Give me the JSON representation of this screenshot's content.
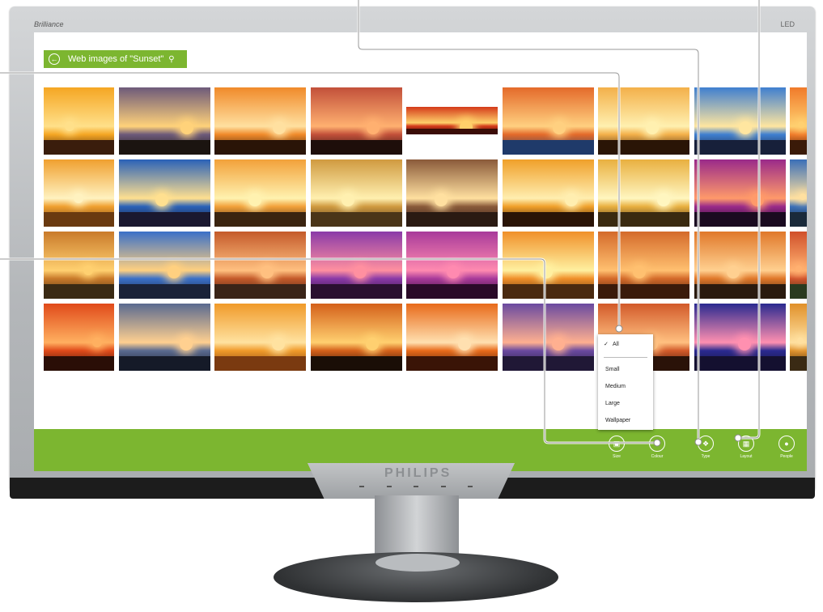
{
  "monitor": {
    "brand_top_left": "Brilliance",
    "brand_top_right": "LED",
    "chin_logo": "PHILIPS"
  },
  "header": {
    "title": "Web images of \"Sunset\"",
    "back_icon": "back-arrow-icon",
    "search_icon": "search-icon"
  },
  "size_menu": {
    "items": [
      {
        "label": "All",
        "checked": true
      },
      {
        "label": "Small",
        "checked": false
      },
      {
        "label": "Medium",
        "checked": false
      },
      {
        "label": "Large",
        "checked": false
      },
      {
        "label": "Wallpaper",
        "checked": false
      }
    ]
  },
  "app_bar": {
    "commands": [
      {
        "label": "Size",
        "icon": "size-icon"
      },
      {
        "label": "Colour",
        "icon": "colour-icon"
      },
      {
        "label": "Type",
        "icon": "type-icon"
      },
      {
        "label": "Layout",
        "icon": "layout-icon"
      },
      {
        "label": "People",
        "icon": "people-icon"
      }
    ]
  },
  "results": {
    "images": [
      {
        "sky": "#f5a623",
        "land": "#3a1d0c",
        "sun": "#ffe08a"
      },
      {
        "sky": "#6d5a7a",
        "land": "#1b1410",
        "sun": "#ffd27a"
      },
      {
        "sky": "#f08a2a",
        "land": "#2a1407",
        "sun": "#ffe0a0"
      },
      {
        "sky": "#c2503a",
        "land": "#1e0e0a",
        "sun": "#ffb070"
      },
      {
        "sky": "#d43a1a",
        "land": "#3b0d07",
        "sun": "#ffd06a"
      },
      {
        "sky": "#e46a2a",
        "land": "#1f3a6a",
        "sun": "#ffd080"
      },
      {
        "sky": "#f3b04a",
        "land": "#2a1506",
        "sun": "#fff0b0"
      },
      {
        "sky": "#3f7fd0",
        "land": "#17203a",
        "sun": "#ffe6a0"
      },
      {
        "sky": "#f07a2a",
        "land": "#3a1a08",
        "sun": "#ffd070"
      },
      {
        "sky": "#f0a030",
        "land": "#6a3a10",
        "sun": "#fff2c0"
      },
      {
        "sky": "#2a62b8",
        "land": "#1a1830",
        "sun": "#ffe090"
      },
      {
        "sky": "#f2a13a",
        "land": "#3a2410",
        "sun": "#fff2b0"
      },
      {
        "sky": "#d09a40",
        "land": "#4a3518",
        "sun": "#fff0b0"
      },
      {
        "sky": "#8a5a3a",
        "land": "#2a1a12",
        "sun": "#ffe0a0"
      },
      {
        "sky": "#f0a02a",
        "land": "#2a1406",
        "sun": "#ffeeb0"
      },
      {
        "sky": "#e9b040",
        "land": "#3a2a10",
        "sun": "#fff6c0"
      },
      {
        "sky": "#9a2a8a",
        "land": "#1a0a20",
        "sun": "#ff9a6a"
      },
      {
        "sky": "#3a6fb8",
        "land": "#1a2a3a",
        "sun": "#ffe0a0"
      },
      {
        "sky": "#c97a2a",
        "land": "#3a2a14",
        "sun": "#ffd070"
      },
      {
        "sky": "#3a70c8",
        "land": "#1a2238",
        "sun": "#ffd080"
      },
      {
        "sky": "#c45a2a",
        "land": "#3a2418",
        "sun": "#ffc080"
      },
      {
        "sky": "#8a3aa8",
        "land": "#2a1030",
        "sun": "#ff90a0"
      },
      {
        "sky": "#a83a9a",
        "land": "#2a0a28",
        "sun": "#ff8ab0"
      },
      {
        "sky": "#f0902a",
        "land": "#4a2a10",
        "sun": "#fff0a0"
      },
      {
        "sky": "#d46a2a",
        "land": "#3a1a0a",
        "sun": "#ffc070"
      },
      {
        "sky": "#e0782a",
        "land": "#2a1a0e",
        "sun": "#ffd090"
      },
      {
        "sky": "#d0502a",
        "land": "#2a3a20",
        "sun": "#ffb070"
      },
      {
        "sky": "#e04a1a",
        "land": "#2a0e06",
        "sun": "#ffb060"
      },
      {
        "sky": "#5a6a90",
        "land": "#151a28",
        "sun": "#ffd090"
      },
      {
        "sky": "#f09a2a",
        "land": "#7a3a10",
        "sun": "#ffe2a0"
      },
      {
        "sky": "#d4601a",
        "land": "#1a0e06",
        "sun": "#ffd070"
      },
      {
        "sky": "#e86a1a",
        "land": "#3a1406",
        "sun": "#ffe0b0"
      },
      {
        "sky": "#6a4aa0",
        "land": "#201836",
        "sun": "#ffb090"
      },
      {
        "sky": "#d25a2a",
        "land": "#2a1208",
        "sun": "#ffc080"
      },
      {
        "sky": "#2a2a90",
        "land": "#141030",
        "sun": "#ff90b0"
      },
      {
        "sky": "#e0902a",
        "land": "#3a2a14",
        "sun": "#ffe0a0"
      }
    ]
  }
}
